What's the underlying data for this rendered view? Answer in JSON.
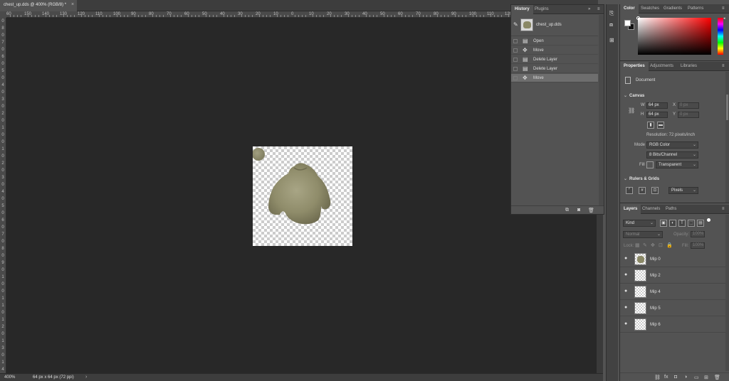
{
  "document": {
    "tab_title": "chest_up.dds @ 400% (RGB/8) *",
    "close_glyph": "×"
  },
  "rulers": {
    "top_labels": [
      "60",
      "150",
      "140",
      "130",
      "120",
      "110",
      "100",
      "90",
      "80",
      "70",
      "60",
      "50",
      "40",
      "30",
      "20",
      "10",
      "0",
      "10",
      "20",
      "30",
      "40",
      "50",
      "60",
      "70",
      "80",
      "90",
      "100",
      "110",
      "120",
      "130",
      "140",
      "150",
      "160"
    ],
    "left_labels": [
      "0",
      "8",
      "0",
      "7",
      "0",
      "6",
      "0",
      "5",
      "0",
      "4",
      "0",
      "3",
      "0",
      "2",
      "0",
      "1",
      "0",
      "0",
      "1",
      "0",
      "2",
      "0",
      "3",
      "0",
      "4",
      "0",
      "5",
      "0",
      "6",
      "0",
      "7",
      "0",
      "8",
      "0",
      "9",
      "0",
      "1",
      "0",
      "0",
      "1",
      "1",
      "0",
      "1",
      "2",
      "0",
      "1",
      "3",
      "0",
      "1",
      "4"
    ]
  },
  "status": {
    "zoom": "400%",
    "info": "64 px x 64 px (72 ppi)",
    "arrow": "›"
  },
  "history_panel": {
    "tabs": [
      "History",
      "Plugins"
    ],
    "collapse_glyph": "»",
    "menu_glyph": "≡",
    "snapshot_name": "chest_up.dds",
    "states": [
      {
        "label": "Open",
        "icon": "document-icon"
      },
      {
        "label": "Move",
        "icon": "move-icon"
      },
      {
        "label": "Delete Layer",
        "icon": "document-icon"
      },
      {
        "label": "Delete Layer",
        "icon": "document-icon"
      },
      {
        "label": "Move",
        "icon": "move-icon"
      }
    ],
    "active_index": 4
  },
  "color_panel": {
    "tabs": [
      "Color",
      "Swatches",
      "Gradients",
      "Patterns"
    ],
    "foreground": "#ffffff",
    "background": "#111111",
    "hue": "#ff0000"
  },
  "properties_panel": {
    "tabs": [
      "Properties",
      "Adjustments",
      "Libraries"
    ],
    "type_label": "Document",
    "canvas_section": "Canvas",
    "w_label": "W",
    "w_value": "64 px",
    "h_label": "H",
    "h_value": "64 px",
    "x_label": "X",
    "x_value": "0 px",
    "y_label": "Y",
    "y_value": "0 px",
    "resolution": "Resolution: 72 pixels/inch",
    "mode_label": "Mode",
    "mode_value": "RGB Color",
    "depth_value": "8 Bits/Channel",
    "fill_label": "Fill",
    "fill_value": "Transparent",
    "rulers_section": "Rulers & Grids",
    "units_value": "Pixels"
  },
  "layers_panel": {
    "tabs": [
      "Layers",
      "Channels",
      "Paths"
    ],
    "filter_kind": "Kind",
    "blend_mode": "Normal",
    "opacity_label": "Opacity:",
    "opacity_value": "100%",
    "lock_label": "Lock:",
    "fill_label": "Fill:",
    "fill_value": "100%",
    "layers": [
      {
        "name": "Mip 0",
        "has_content": true
      },
      {
        "name": "Mip 2",
        "has_content": false
      },
      {
        "name": "Mip 4",
        "has_content": false
      },
      {
        "name": "Mip 5",
        "has_content": false
      },
      {
        "name": "Mip 6",
        "has_content": false
      }
    ]
  },
  "icons": {
    "eye": "●",
    "move": "✥",
    "doc": "▤",
    "brush": "✎",
    "menu": "≡",
    "caret": "⌄",
    "chevron_down": "⌄",
    "link": "⛓"
  }
}
